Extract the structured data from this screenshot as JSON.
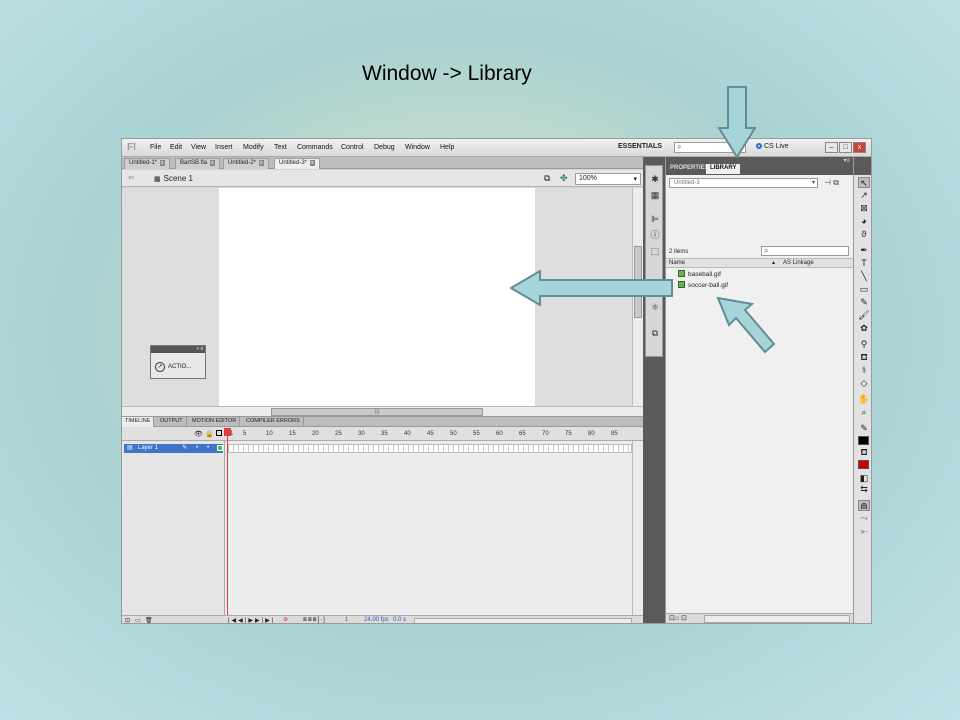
{
  "slide": {
    "title": "Window -> Library"
  },
  "app": {
    "logo": "Fl",
    "menu": [
      "File",
      "Edit",
      "View",
      "Insert",
      "Modify",
      "Text",
      "Commands",
      "Control",
      "Debug",
      "Window",
      "Help"
    ],
    "workspace": "ESSENTIALS",
    "cs_live": "CS Live",
    "window_buttons": {
      "minimize": "–",
      "maximize": "□",
      "close": "x"
    }
  },
  "document_tabs": [
    {
      "label": "Untitled-1*"
    },
    {
      "label": "BartSB.fla"
    },
    {
      "label": "Untitled-2*"
    },
    {
      "label": "Untitled-3*",
      "active": true
    }
  ],
  "edit_bar": {
    "scene": "Scene 1",
    "zoom": "100%"
  },
  "actions_panel": {
    "label": "ACTIO..."
  },
  "timeline": {
    "tabs": [
      "TIMELINE",
      "OUTPUT",
      "MOTION EDITOR",
      "COMPILER ERRORS"
    ],
    "frame_numbers": [
      "1",
      "5",
      "10",
      "15",
      "20",
      "25",
      "30",
      "35",
      "40",
      "45",
      "50",
      "55",
      "60",
      "65",
      "70",
      "75",
      "80",
      "85"
    ],
    "layer": "Layer 1",
    "current_frame": "1",
    "fps": "24.00 fps",
    "time": "0.0 s"
  },
  "panel": {
    "tabs": [
      "PROPERTIES",
      "LIBRARY"
    ],
    "active_tab": "LIBRARY",
    "document": "Untitled-3",
    "items_count": "2 items",
    "columns": {
      "name": "Name",
      "linkage": "AS Linkage"
    },
    "items": [
      {
        "name": "baseball.gif"
      },
      {
        "name": "soccer-ball.gif"
      }
    ]
  },
  "colors": {
    "arrow_fill": "#a6d4d8",
    "arrow_stroke": "#5f8e94",
    "fill_swatch": "#cc0000",
    "stroke_swatch": "#000000"
  }
}
